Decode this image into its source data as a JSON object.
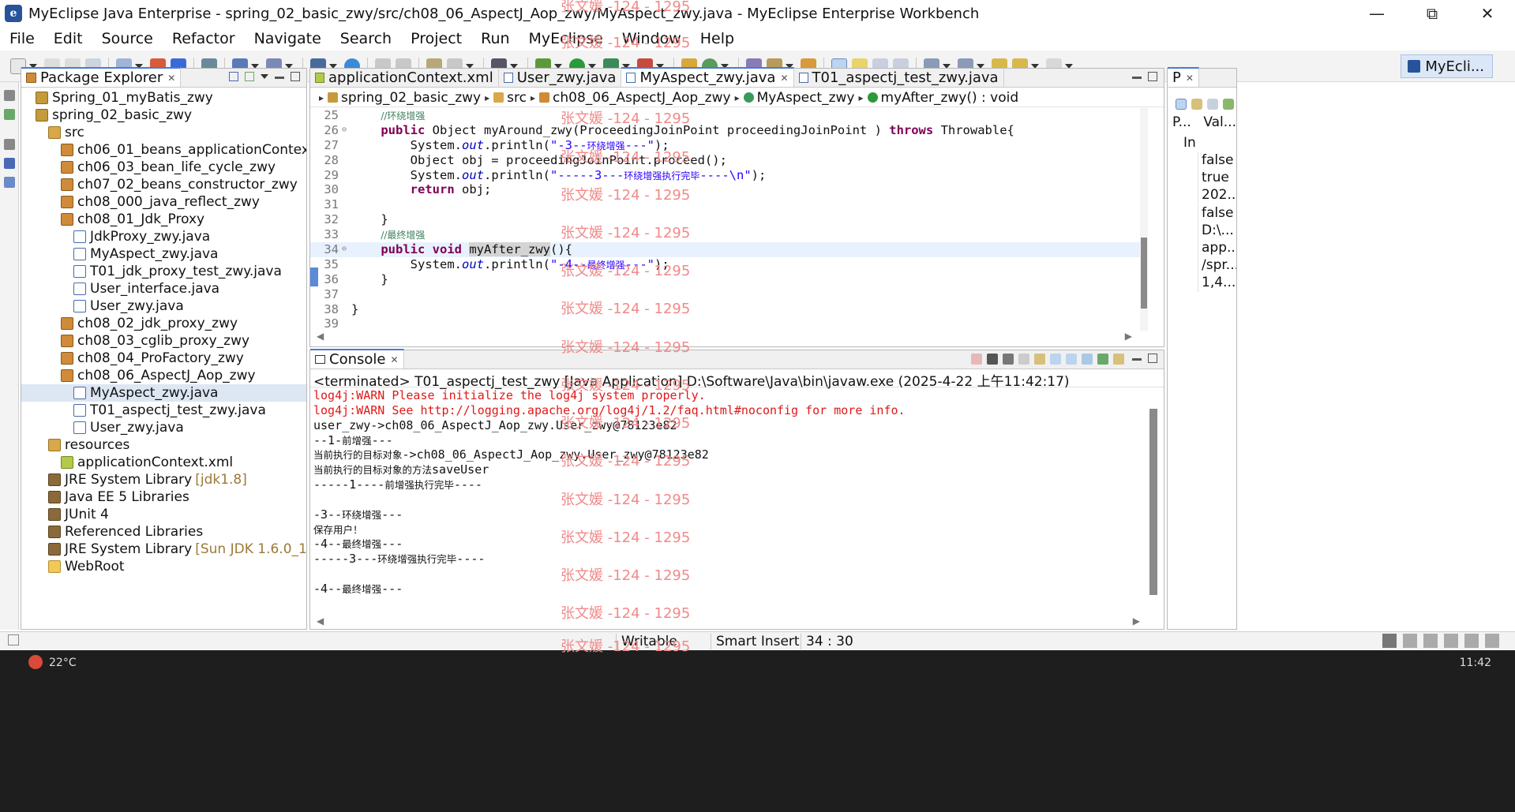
{
  "window": {
    "title": "MyEclipse Java Enterprise - spring_02_basic_zwy/src/ch08_06_AspectJ_Aop_zwy/MyAspect_zwy.java - MyEclipse Enterprise Workbench",
    "minimize": "—",
    "maximize": "⧉",
    "close": "✕"
  },
  "menu": [
    "File",
    "Edit",
    "Source",
    "Refactor",
    "Navigate",
    "Search",
    "Project",
    "Run",
    "MyEclipse",
    "Window",
    "Help"
  ],
  "perspective": {
    "label": "MyEcli..."
  },
  "package_explorer": {
    "title": "Package Explorer",
    "tree": [
      {
        "label": "Spring_01_myBatis_zwy",
        "indent": 1,
        "icon": "project-icon"
      },
      {
        "label": "spring_02_basic_zwy",
        "indent": 1,
        "icon": "project-icon"
      },
      {
        "label": "src",
        "indent": 2,
        "icon": "source-folder-icon"
      },
      {
        "label": "ch06_01_beans_applicationContext_zwy",
        "indent": 3,
        "icon": "package-icon"
      },
      {
        "label": "ch06_03_bean_life_cycle_zwy",
        "indent": 3,
        "icon": "package-icon"
      },
      {
        "label": "ch07_02_beans_constructor_zwy",
        "indent": 3,
        "icon": "package-icon"
      },
      {
        "label": "ch08_000_java_reflect_zwy",
        "indent": 3,
        "icon": "package-icon"
      },
      {
        "label": "ch08_01_Jdk_Proxy",
        "indent": 3,
        "icon": "package-icon"
      },
      {
        "label": "JdkProxy_zwy.java",
        "indent": 4,
        "icon": "java-file-icon"
      },
      {
        "label": "MyAspect_zwy.java",
        "indent": 4,
        "icon": "java-file-icon"
      },
      {
        "label": "T01_jdk_proxy_test_zwy.java",
        "indent": 4,
        "icon": "java-file-icon"
      },
      {
        "label": "User_interface.java",
        "indent": 4,
        "icon": "java-file-icon"
      },
      {
        "label": "User_zwy.java",
        "indent": 4,
        "icon": "java-file-icon"
      },
      {
        "label": "ch08_02_jdk_proxy_zwy",
        "indent": 3,
        "icon": "package-icon"
      },
      {
        "label": "ch08_03_cglib_proxy_zwy",
        "indent": 3,
        "icon": "package-icon"
      },
      {
        "label": "ch08_04_ProFactory_zwy",
        "indent": 3,
        "icon": "package-icon"
      },
      {
        "label": "ch08_06_AspectJ_Aop_zwy",
        "indent": 3,
        "icon": "package-icon"
      },
      {
        "label": "MyAspect_zwy.java",
        "indent": 4,
        "icon": "java-file-icon",
        "selected": true
      },
      {
        "label": "T01_aspectj_test_zwy.java",
        "indent": 4,
        "icon": "java-file-icon"
      },
      {
        "label": "User_zwy.java",
        "indent": 4,
        "icon": "java-file-icon"
      },
      {
        "label": "resources",
        "indent": 2,
        "icon": "source-folder-icon"
      },
      {
        "label": "applicationContext.xml",
        "indent": 3,
        "icon": "xml-file-icon"
      },
      {
        "label": "JRE System Library",
        "version": "[jdk1.8]",
        "indent": 2,
        "icon": "library-icon"
      },
      {
        "label": "Java EE 5 Libraries",
        "indent": 2,
        "icon": "library-icon"
      },
      {
        "label": "JUnit 4",
        "indent": 2,
        "icon": "library-icon"
      },
      {
        "label": "Referenced Libraries",
        "indent": 2,
        "icon": "library-icon"
      },
      {
        "label": "JRE System Library",
        "version": "[Sun JDK 1.6.0_13]",
        "indent": 2,
        "icon": "library-icon"
      },
      {
        "label": "WebRoot",
        "indent": 2,
        "icon": "folder-icon"
      }
    ]
  },
  "editor": {
    "tabs": [
      {
        "label": "applicationContext.xml",
        "active": false
      },
      {
        "label": "User_zwy.java",
        "active": false
      },
      {
        "label": "MyAspect_zwy.java",
        "active": true
      },
      {
        "label": "T01_aspectj_test_zwy.java",
        "active": false
      }
    ],
    "breadcrumb": [
      "spring_02_basic_zwy",
      "src",
      "ch08_06_AspectJ_Aop_zwy",
      "MyAspect_zwy",
      "myAfter_zwy() : void"
    ],
    "current_line": 34,
    "code_lines": [
      {
        "num": "25",
        "fold": "",
        "segs": [
          {
            "t": "    ",
            "c": ""
          },
          {
            "t": "//环绕增强",
            "c": "cm"
          }
        ]
      },
      {
        "num": "26",
        "fold": "⊖",
        "segs": [
          {
            "t": "    ",
            "c": ""
          },
          {
            "t": "public",
            "c": "kw"
          },
          {
            "t": " Object myAround_zwy(ProceedingJoinPoint proceedingJoinPoint ) ",
            "c": ""
          },
          {
            "t": "throws",
            "c": "kw"
          },
          {
            "t": " Throwable{",
            "c": ""
          }
        ]
      },
      {
        "num": "27",
        "fold": "",
        "segs": [
          {
            "t": "        System.",
            "c": ""
          },
          {
            "t": "out",
            "c": "fld"
          },
          {
            "t": ".println(",
            "c": ""
          },
          {
            "t": "\"-3--",
            "c": "str"
          },
          {
            "t": "环绕增强",
            "c": "str cmz"
          },
          {
            "t": "---\"",
            "c": "str"
          },
          {
            "t": ");",
            "c": ""
          }
        ]
      },
      {
        "num": "28",
        "fold": "",
        "segs": [
          {
            "t": "        Object obj = proceedingJoinPoint.proceed();",
            "c": ""
          }
        ]
      },
      {
        "num": "29",
        "fold": "",
        "segs": [
          {
            "t": "        System.",
            "c": ""
          },
          {
            "t": "out",
            "c": "fld"
          },
          {
            "t": ".println(",
            "c": ""
          },
          {
            "t": "\"-----3---",
            "c": "str"
          },
          {
            "t": "环绕增强执行完毕",
            "c": "str cmz"
          },
          {
            "t": "----\\n\"",
            "c": "str"
          },
          {
            "t": ");",
            "c": ""
          }
        ]
      },
      {
        "num": "30",
        "fold": "",
        "segs": [
          {
            "t": "        ",
            "c": ""
          },
          {
            "t": "return",
            "c": "kw"
          },
          {
            "t": " obj;",
            "c": ""
          }
        ]
      },
      {
        "num": "31",
        "fold": "",
        "segs": [
          {
            "t": "",
            "c": ""
          }
        ]
      },
      {
        "num": "32",
        "fold": "",
        "segs": [
          {
            "t": "    }",
            "c": ""
          }
        ]
      },
      {
        "num": "33",
        "fold": "",
        "segs": [
          {
            "t": "    ",
            "c": ""
          },
          {
            "t": "//最终增强",
            "c": "cm"
          }
        ]
      },
      {
        "num": "34",
        "fold": "⊖",
        "segs": [
          {
            "t": "    ",
            "c": ""
          },
          {
            "t": "public",
            "c": "kw"
          },
          {
            "t": " ",
            "c": ""
          },
          {
            "t": "void",
            "c": "kw"
          },
          {
            "t": " ",
            "c": ""
          },
          {
            "t": "myAfter_zwy",
            "c": "hl"
          },
          {
            "t": "(){",
            "c": ""
          }
        ]
      },
      {
        "num": "35",
        "fold": "",
        "segs": [
          {
            "t": "        System.",
            "c": ""
          },
          {
            "t": "out",
            "c": "fld"
          },
          {
            "t": ".println(",
            "c": ""
          },
          {
            "t": "\"-4--",
            "c": "str"
          },
          {
            "t": "最终增强",
            "c": "str cmz"
          },
          {
            "t": "---\"",
            "c": "str"
          },
          {
            "t": ");",
            "c": ""
          }
        ]
      },
      {
        "num": "36",
        "fold": "",
        "segs": [
          {
            "t": "    }",
            "c": ""
          }
        ]
      },
      {
        "num": "37",
        "fold": "",
        "segs": [
          {
            "t": "",
            "c": ""
          }
        ]
      },
      {
        "num": "38",
        "fold": "",
        "segs": [
          {
            "t": "}",
            "c": ""
          }
        ]
      },
      {
        "num": "39",
        "fold": "",
        "segs": [
          {
            "t": "",
            "c": ""
          }
        ]
      }
    ]
  },
  "properties": {
    "tab": "P",
    "col_property": "P...",
    "col_value": "Val...",
    "group": "In",
    "values": [
      "false",
      "true",
      "202...",
      "false",
      "D:\\...",
      "app...",
      "/spr...",
      "1,4..."
    ]
  },
  "console": {
    "title": "Console",
    "status": "<terminated> T01_aspectj_test_zwy [Java Application] D:\\Software\\Java\\bin\\javaw.exe (2025-4-22 上午11:42:17)",
    "lines": [
      {
        "text": "log4j:WARN Please initialize the log4j system properly.",
        "err": true
      },
      {
        "text": "log4j:WARN See http://logging.apache.org/log4j/1.2/faq.html#noconfig for more info.",
        "err": true
      },
      {
        "text": "user_zwy->ch08_06_AspectJ_Aop_zwy.User_zwy@78123e82",
        "err": false
      },
      {
        "text": "--1-前增强---",
        "err": false
      },
      {
        "text": "当前执行的目标对象->ch08_06_AspectJ_Aop_zwy.User_zwy@78123e82",
        "err": false
      },
      {
        "text": "当前执行的目标对象的方法saveUser",
        "err": false
      },
      {
        "text": "-----1----前增强执行完毕----",
        "err": false
      },
      {
        "text": "",
        "err": false
      },
      {
        "text": "-3--环绕增强---",
        "err": false
      },
      {
        "text": "保存用户！",
        "err": false
      },
      {
        "text": "-4--最终增强---",
        "err": false
      },
      {
        "text": "-----3---环绕增强执行完毕----",
        "err": false
      },
      {
        "text": "",
        "err": false
      },
      {
        "text": "-4--最终增强---",
        "err": false
      }
    ]
  },
  "statusbar": {
    "writable": "Writable",
    "insert_mode": "Smart Insert",
    "position": "34 : 30"
  },
  "watermark": "张文媛 -124 - 1295",
  "taskbar": {
    "weather": "22°C",
    "clock": "11:42"
  }
}
